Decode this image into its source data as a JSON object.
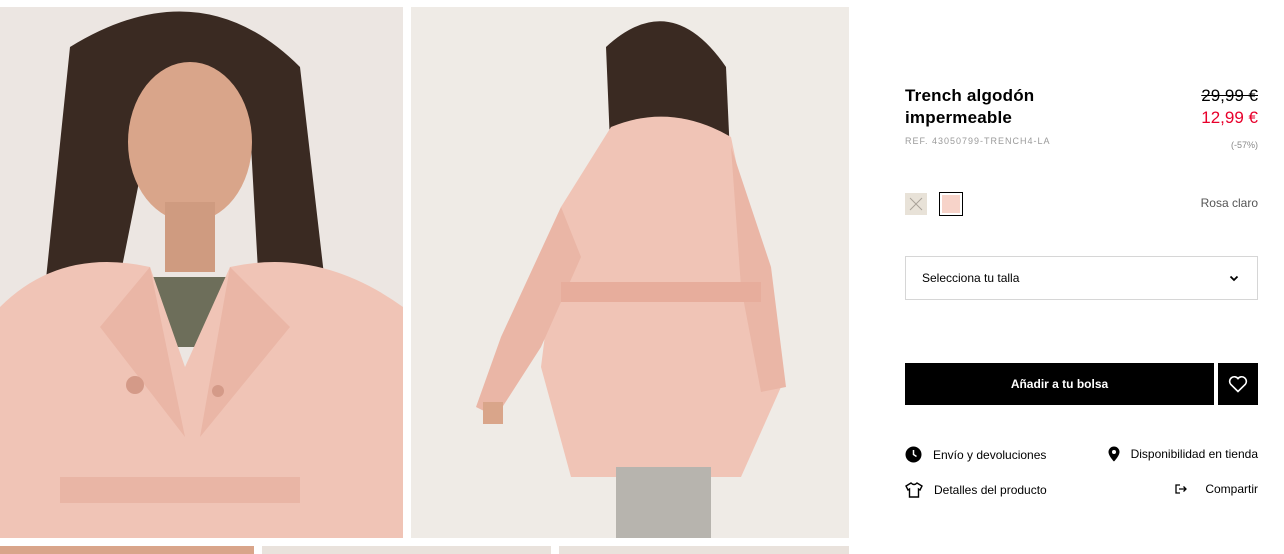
{
  "product": {
    "title": "Trench algodón impermeable",
    "ref": "REF. 43050799-TRENCH4-LA",
    "old_price": "29,99 €",
    "new_price": "12,99 €",
    "discount": "(-57%)",
    "selected_color": "Rosa claro"
  },
  "colors": {
    "sale_price": "#e8002b",
    "swatch_beige": "#e8e2d8",
    "swatch_pink": "#f7d3c9",
    "coat": "#f0c4b6"
  },
  "size_select": {
    "label": "Selecciona tu talla",
    "icon": "chevron-down-icon"
  },
  "actions": {
    "add_to_bag": "Añadir a tu bolsa",
    "favorite_icon": "heart-icon"
  },
  "links": {
    "shipping": "Envío y devoluciones",
    "store": "Disponibilidad en tienda",
    "details": "Detalles del producto",
    "share": "Compartir"
  }
}
